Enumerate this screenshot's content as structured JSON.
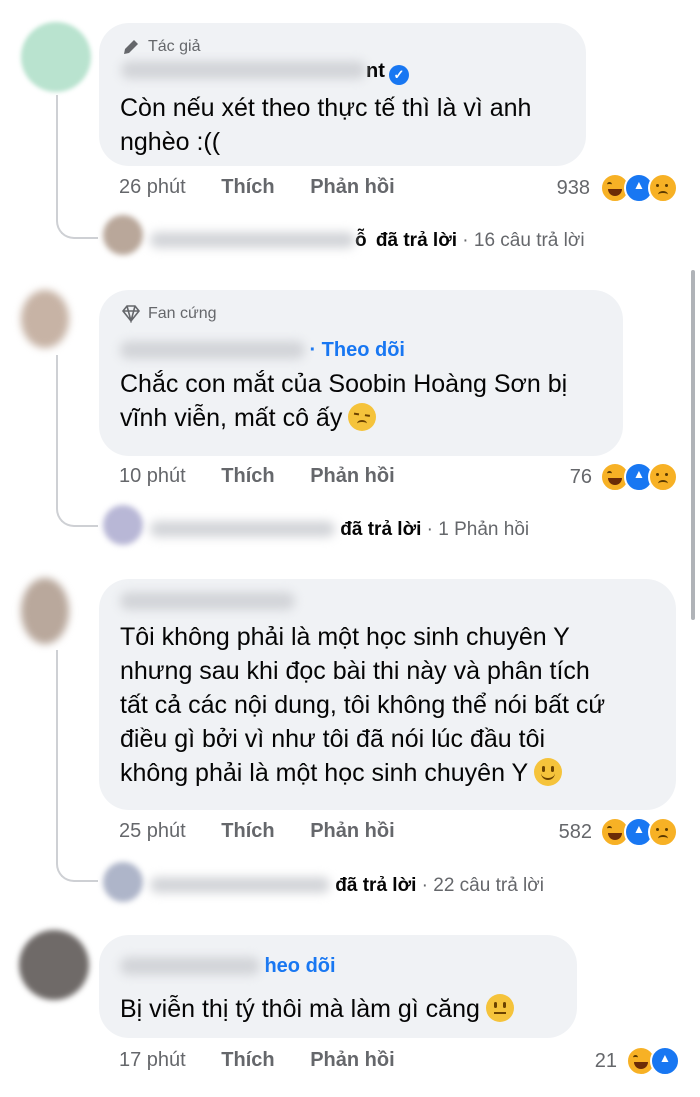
{
  "comments": [
    {
      "badge": "Tác giả",
      "name_suffix": "nt",
      "text_lines": [
        "Còn nếu xét theo thực tế thì là vì anh",
        "nghèo :(("
      ],
      "time": "26 phút",
      "like": "Thích",
      "reply": "Phản hồi",
      "reaction_count": "938",
      "replied_name_tail": "ỗ",
      "replied_text": "đã trả lời",
      "replies_count_text": "16 câu trả lời"
    },
    {
      "badge": "Fan cứng",
      "follow": "Theo dõi",
      "text_lines": [
        "Chắc con mắt của Soobin Hoàng Sơn bị",
        "vĩnh viễn, mất cô ấy"
      ],
      "time": "10 phút",
      "like": "Thích",
      "reply": "Phản hồi",
      "reaction_count": "76",
      "replied_text": "đã trả lời",
      "replies_count_text": "1 Phản hồi"
    },
    {
      "text_lines": [
        "Tôi không phải là một học sinh chuyên Y",
        "nhưng sau khi đọc bài thi này và phân tích",
        "tất cả các nội dung, tôi không thể nói bất cứ",
        "điều gì bởi vì như tôi đã nói lúc đầu tôi",
        "không phải là một học sinh chuyên Y"
      ],
      "time": "25 phút",
      "like": "Thích",
      "reply": "Phản hồi",
      "reaction_count": "582",
      "replied_text": "đã trả lời",
      "replies_count_text": "22 câu trả lời"
    },
    {
      "follow": "heo dõi",
      "text_lines": [
        "Bị viễn thị tý thôi mà làm gì căng"
      ],
      "time": "17 phút",
      "like": "Thích",
      "reply": "Phản hồi",
      "reaction_count": "21"
    }
  ],
  "icons": {
    "author_badge": "pencil-icon",
    "fan_badge": "diamond-icon",
    "verified": "verified-check-icon",
    "reactions": [
      "haha-reaction-icon",
      "like-reaction-icon",
      "sad-reaction-icon"
    ]
  },
  "colors": {
    "bubble": "#f0f2f5",
    "meta_text": "#65676b",
    "accent_blue": "#1877f2",
    "thread_line": "#ced0d4"
  }
}
